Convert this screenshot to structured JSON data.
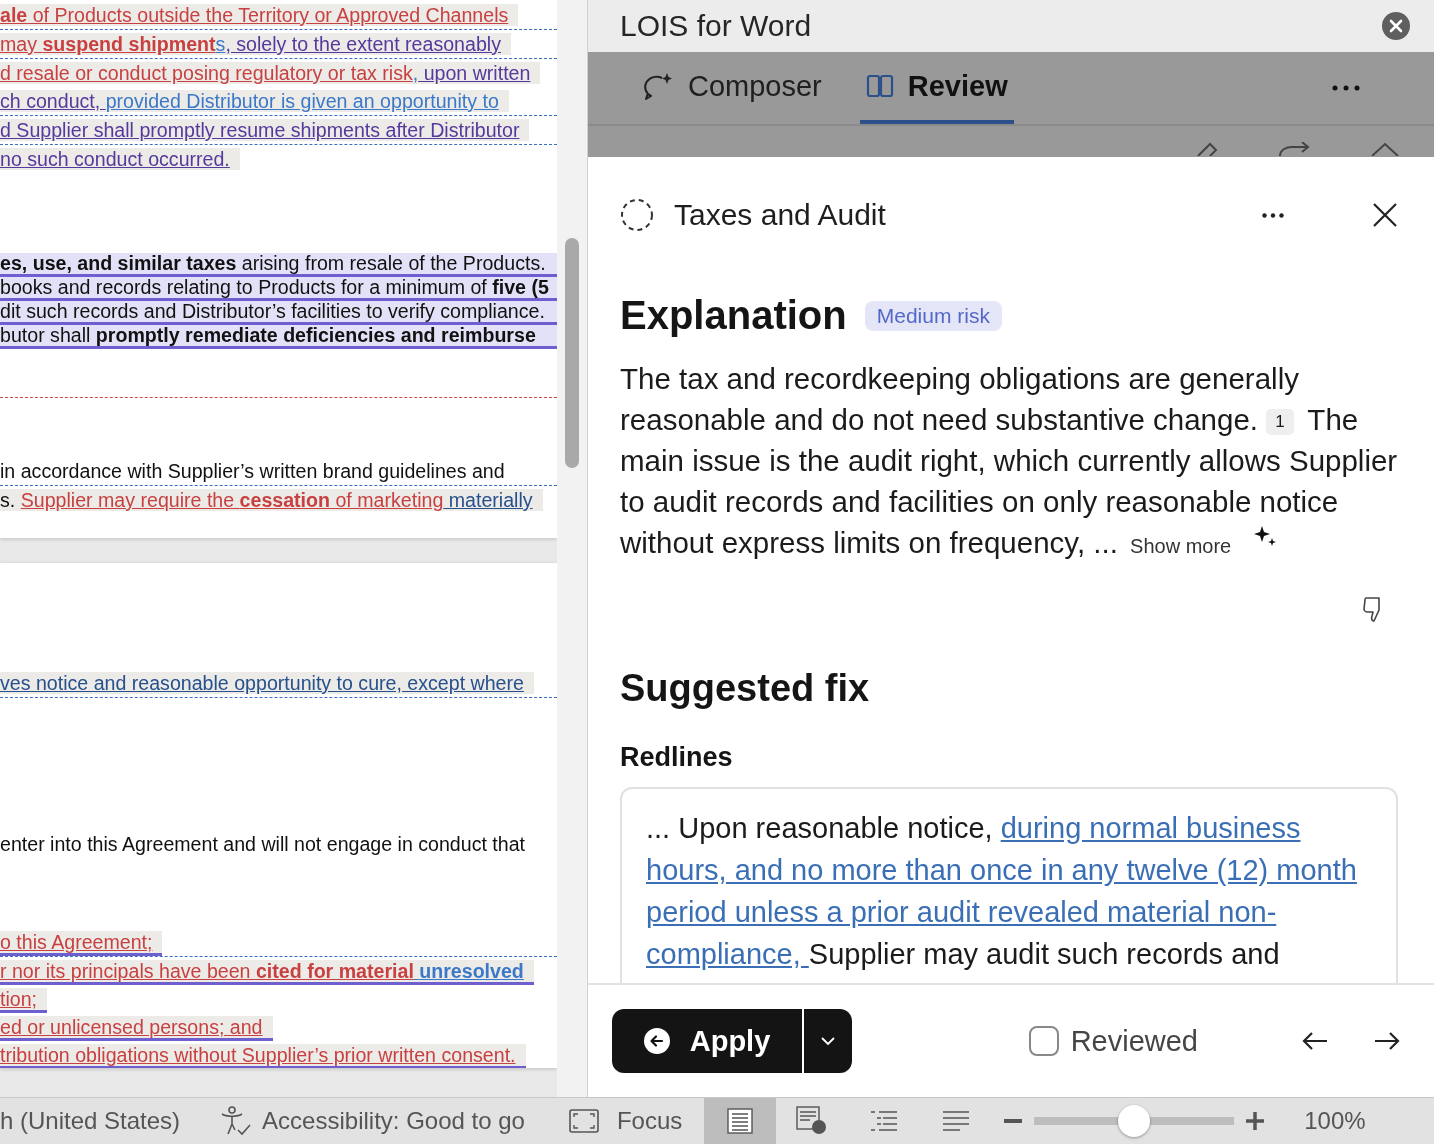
{
  "document": {
    "pages": [
      {
        "blocks": [
          {
            "kind": "text",
            "lines": [
              {
                "kind": "grey",
                "rule_above": false,
                "rule_below": false,
                "segments": [
                  {
                    "kind": "del",
                    "text": "**ale** of Products outside the Territory or Approved Channels"
                  }
                ]
              },
              {
                "kind": "grey",
                "rule_above": true,
                "rule_below": false,
                "segments": [
                  {
                    "kind": "del",
                    "text": "may **suspend shipment**"
                  },
                  {
                    "kind": "ins",
                    "text": "s"
                  },
                  {
                    "kind": "moved",
                    "text": ", solely to the extent reasonably"
                  }
                ]
              },
              {
                "kind": "grey",
                "rule_above": true,
                "rule_below": false,
                "segments": [
                  {
                    "kind": "del",
                    "text": "d resale or conduct posing regulatory or tax risk"
                  },
                  {
                    "kind": "ins",
                    "text": ","
                  },
                  {
                    "kind": "moved",
                    "text": " upon written"
                  }
                ]
              },
              {
                "kind": "grey",
                "rule_above": false,
                "rule_below": false,
                "segments": [
                  {
                    "kind": "moved",
                    "text": "ch conduct, "
                  },
                  {
                    "kind": "ins",
                    "text": "provided Distributor is given an opportunity to"
                  }
                ]
              },
              {
                "kind": "grey",
                "rule_above": true,
                "rule_below": false,
                "segments": [
                  {
                    "kind": "moved",
                    "text": "d Supplier shall promptly resume shipments after Distributor"
                  }
                ]
              },
              {
                "kind": "grey",
                "rule_above": true,
                "rule_below": false,
                "segments": [
                  {
                    "kind": "moved",
                    "text": "no such conduct occurred."
                  }
                ]
              }
            ]
          },
          {
            "kind": "text",
            "lines": [
              {
                "kind": "lavender",
                "rule_above": false,
                "rule_below": false,
                "segments": [
                  {
                    "kind": "plain",
                    "text": "**es, use, and similar taxes** arising from resale of the Products."
                  }
                ]
              },
              {
                "kind": "lavender",
                "rule_above": false,
                "rule_below": false,
                "segments": [
                  {
                    "kind": "plain",
                    "text": "books and records relating to Products for a minimum of **five (5**"
                  }
                ]
              },
              {
                "kind": "lavender",
                "rule_above": false,
                "rule_below": false,
                "segments": [
                  {
                    "kind": "plain",
                    "text": "dit such records and Distributor’s facilities to verify compliance."
                  }
                ]
              },
              {
                "kind": "lavender",
                "rule_above": false,
                "rule_below": false,
                "segments": [
                  {
                    "kind": "plain",
                    "text": "butor shall **promptly remediate deficiencies and reimburse**"
                  }
                ]
              }
            ]
          },
          {
            "kind": "rule"
          },
          {
            "kind": "text",
            "lines": [
              {
                "kind": "plain",
                "rule_above": false,
                "rule_below": false,
                "segments": [
                  {
                    "kind": "plain",
                    "text": "in accordance with Supplier’s written brand guidelines and"
                  }
                ]
              },
              {
                "kind": "grey",
                "rule_above": true,
                "rule_below": false,
                "segments": [
                  {
                    "kind": "plain",
                    "text": "s. "
                  },
                  {
                    "kind": "del",
                    "text": "Supplier may require the **cessation** of marketing"
                  },
                  {
                    "kind": "dark",
                    "text": " materially"
                  }
                ]
              }
            ]
          }
        ]
      },
      {
        "blocks": [
          {
            "kind": "text",
            "lines": [
              {
                "kind": "grey",
                "rule_above": false,
                "rule_below": true,
                "segments": [
                  {
                    "kind": "dark",
                    "text": "ves notice and reasonable opportunity to cure, except where"
                  }
                ]
              }
            ]
          },
          {
            "kind": "text",
            "lines": [
              {
                "kind": "plain",
                "rule_above": false,
                "rule_below": false,
                "segments": [
                  {
                    "kind": "plain",
                    "text": "enter into this Agreement and will not engage in conduct that"
                  }
                ]
              }
            ]
          },
          {
            "kind": "text",
            "lines": [
              {
                "kind": "grey-purple",
                "rule_above": false,
                "rule_below": false,
                "segments": [
                  {
                    "kind": "del",
                    "text": "o this Agreement;"
                  }
                ]
              },
              {
                "kind": "grey-purple",
                "rule_above": true,
                "rule_below": false,
                "segments": [
                  {
                    "kind": "del",
                    "text": "r nor its principals have been **cited for material**"
                  },
                  {
                    "kind": "ins",
                    "text": " **unresolved**"
                  }
                ]
              },
              {
                "kind": "grey-purple",
                "rule_above": false,
                "rule_below": false,
                "segments": [
                  {
                    "kind": "del",
                    "text": "tion;"
                  }
                ]
              },
              {
                "kind": "grey-purple",
                "rule_above": false,
                "rule_below": false,
                "segments": [
                  {
                    "kind": "del",
                    "text": "ed or unlicensed persons; and"
                  }
                ]
              },
              {
                "kind": "grey-purple",
                "rule_above": false,
                "rule_below": false,
                "segments": [
                  {
                    "kind": "del",
                    "text": "tribution obligations without Supplier’s prior written consent."
                  }
                ]
              }
            ]
          }
        ]
      }
    ]
  },
  "pane": {
    "title": "LOIS for Word",
    "tabs": [
      {
        "label": "Composer",
        "kind": "composer",
        "selected": false
      },
      {
        "label": "Review",
        "kind": "review",
        "selected": true
      }
    ],
    "issue": {
      "title": "Taxes and Audit",
      "explanation": {
        "heading": "Explanation",
        "risk": "Medium risk",
        "text_before": "The tax and recordkeeping obligations are generally reasonable and do not need substantive change.",
        "citation": "1",
        "text_after": "The main issue is the audit right, which currently allows Supplier to audit records and facilities on only reasonable notice without express limits on frequency, ...",
        "show_more": "Show more"
      },
      "fix": {
        "heading": "Suggested fix",
        "subheading": "Redlines",
        "redline": [
          {
            "kind": "plain",
            "text": "... Upon reasonable notice, "
          },
          {
            "kind": "insert",
            "text": "during normal business hours, and no more than once in any twelve (12) month period unless a prior audit revealed material non-compliance, "
          },
          {
            "kind": "plain",
            "text": "Supplier may audit such records and"
          }
        ]
      }
    },
    "footer": {
      "apply": "Apply",
      "reviewed": {
        "label": "Reviewed",
        "checked": false
      }
    }
  },
  "status_bar": {
    "language": "h (United States)",
    "accessibility": "Accessibility: Good to go",
    "focus": "Focus",
    "views": [
      {
        "kind": "print",
        "selected": true
      },
      {
        "kind": "web",
        "selected": false
      },
      {
        "kind": "outline",
        "selected": false
      },
      {
        "kind": "draft",
        "selected": false
      }
    ],
    "zoom": {
      "level": 0.5,
      "reading": "100%"
    }
  }
}
